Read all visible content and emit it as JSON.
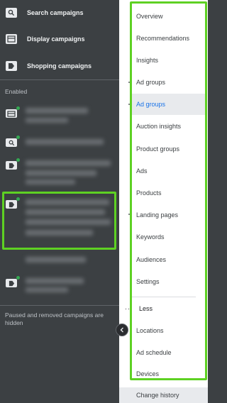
{
  "sidebar": {
    "campaign_types": [
      {
        "label": "Search campaigns",
        "icon": "search-icon"
      },
      {
        "label": "Display campaigns",
        "icon": "display-icon"
      },
      {
        "label": "Shopping campaigns",
        "icon": "shopping-tag-icon"
      }
    ],
    "section_label": "Enabled",
    "hidden_note": "Paused and removed campaigns are hidden",
    "status_color": "#34a853",
    "highlight_color": "#5ed123"
  },
  "nav": {
    "items": [
      {
        "label": "Overview"
      },
      {
        "label": "Recommendations"
      },
      {
        "label": "Insights"
      },
      {
        "label": "Ad groups"
      },
      {
        "label": "Ad groups"
      },
      {
        "label": "Auction insights"
      },
      {
        "label": "Product groups"
      },
      {
        "label": "Ads"
      },
      {
        "label": "Products"
      },
      {
        "label": "Landing pages"
      },
      {
        "label": "Keywords"
      },
      {
        "label": "Audiences"
      },
      {
        "label": "Settings"
      }
    ],
    "less_label": "Less",
    "more_items": [
      {
        "label": "Locations"
      },
      {
        "label": "Ad schedule"
      },
      {
        "label": "Devices"
      }
    ],
    "bottom_item": "Change history",
    "active_color": "#1a73e8"
  }
}
